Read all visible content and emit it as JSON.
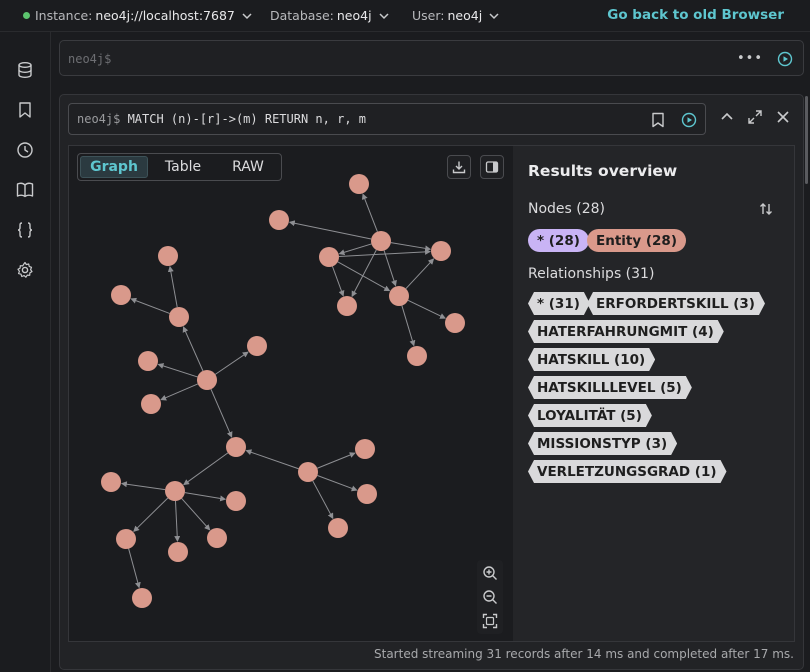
{
  "topbar": {
    "instance_label": "Instance:",
    "instance_value": "neo4j://localhost:7687",
    "database_label": "Database:",
    "database_value": "neo4j",
    "user_label": "User:",
    "user_value": "neo4j",
    "old_browser_link": "Go back to old Browser",
    "status_color": "#5cc46e",
    "accent_color": "#5ec6cf"
  },
  "sidebar": {
    "icons": [
      "database-icon",
      "bookmark-icon",
      "history-icon",
      "book-icon",
      "braces-icon",
      "gear-icon"
    ]
  },
  "editor": {
    "placeholder": "neo4j$"
  },
  "frame": {
    "prompt": "neo4j$",
    "query": " MATCH (n)-[r]->(m) RETURN n, r, m",
    "tabs": [
      "Graph",
      "Table",
      "RAW"
    ],
    "active_tab": "Graph",
    "status": "Started streaming 31 records after 14 ms and completed after 17 ms."
  },
  "overview": {
    "title": "Results overview",
    "nodes_heading": "Nodes (28)",
    "node_labels": [
      {
        "text": "* (28)",
        "color": "#c9b4f5"
      },
      {
        "text": "Entity (28)",
        "color": "#d9998b"
      }
    ],
    "rels_heading": "Relationships (31)",
    "rel_types": [
      "* (31)",
      "ERFORDERTSKILL (3)",
      "HATERFAHRUNGMIT (4)",
      "HATSKILL (10)",
      "HATSKILLLEVEL (5)",
      "LOYALITÄT (5)",
      "MISSIONSTYP (3)",
      "VERLETZUNGSGRAD (1)"
    ]
  },
  "graph": {
    "node_color": "#d9998b"
  }
}
